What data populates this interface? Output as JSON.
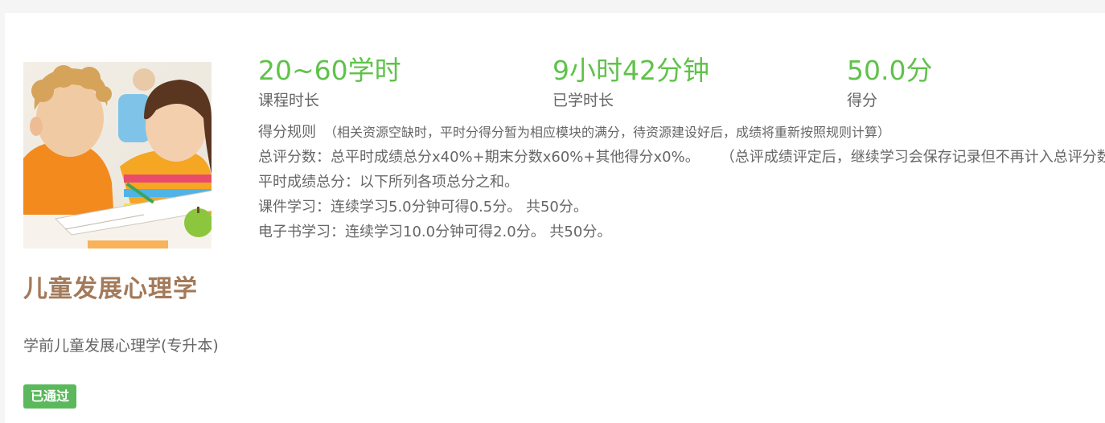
{
  "course": {
    "title": "儿童发展心理学",
    "subtitle": "学前儿童发展心理学(专升本)",
    "status_badge": "已通过"
  },
  "stats": [
    {
      "value": "20~60学时",
      "label": "课程时长"
    },
    {
      "value": "9小时42分钟",
      "label": "已学时长"
    },
    {
      "value": "50.0分",
      "label": "得分"
    }
  ],
  "rules": {
    "title": "得分规则",
    "note": "（相关资源空缺时，平时分得分暂为相应模块的满分，待资源建设好后，成绩将重新按照规则计算）",
    "total_formula": "总评分数：总平时成绩总分x40%+期末分数x60%+其他得分x0%。",
    "total_note": "（总评成绩评定后，继续学习会保存记录但不再计入总评分数）",
    "usual_total": "平时成绩总分：以下所列各项总分之和。",
    "items": [
      "课件学习：连续学习5.0分钟可得0.5分。 共50分。",
      "电子书学习：连续学习10.0分钟可得2.0分。 共50分。"
    ]
  },
  "colors": {
    "accent_green": "#5fc24a",
    "badge_green": "#5cb85c",
    "title_brown": "#a37a5a"
  },
  "icons": {
    "cover": "course-cover-image-two-children-reading"
  }
}
